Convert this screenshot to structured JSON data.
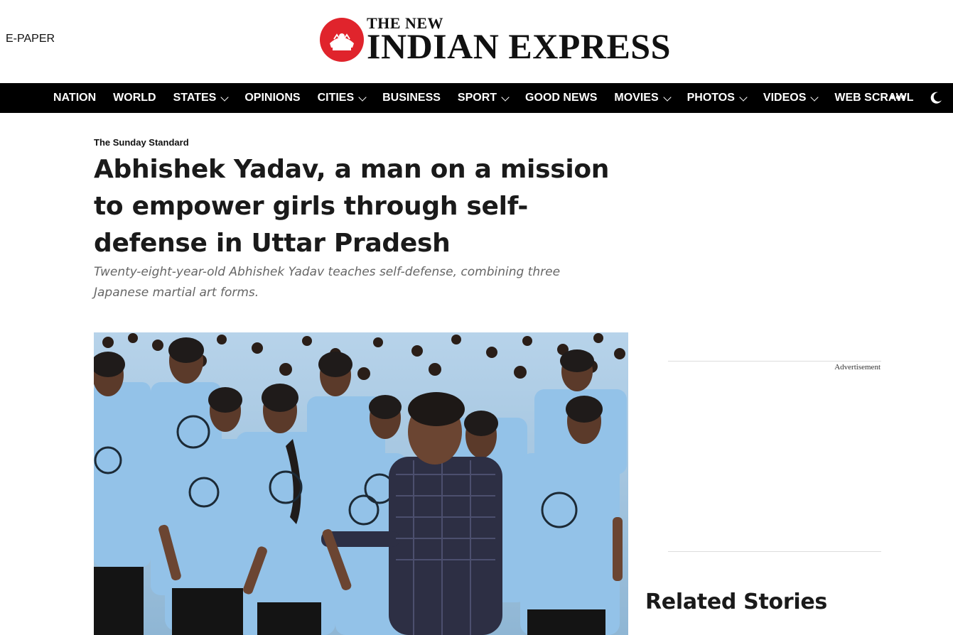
{
  "header": {
    "epaper_label": "E-PAPER",
    "logo_line1": "THE NEW",
    "logo_line2": "INDIAN EXPRESS"
  },
  "nav": {
    "items": [
      {
        "label": "NATION",
        "dropdown": false
      },
      {
        "label": "WORLD",
        "dropdown": false
      },
      {
        "label": "STATES",
        "dropdown": true
      },
      {
        "label": "OPINIONS",
        "dropdown": false
      },
      {
        "label": "CITIES",
        "dropdown": true
      },
      {
        "label": "BUSINESS",
        "dropdown": false
      },
      {
        "label": "SPORT",
        "dropdown": true
      },
      {
        "label": "GOOD NEWS",
        "dropdown": false
      },
      {
        "label": "MOVIES",
        "dropdown": true
      },
      {
        "label": "PHOTOS",
        "dropdown": true
      },
      {
        "label": "VIDEOS",
        "dropdown": true
      },
      {
        "label": "WEB SCRAWL",
        "dropdown": false
      }
    ],
    "more_label": "•••",
    "theme_icon": "moon-icon"
  },
  "article": {
    "section": "The Sunday Standard",
    "title": "Abhishek Yadav, a man on a mission to empower girls through self-defense in Uttar Pradesh",
    "subtitle": "Twenty-eight-year-old Abhishek Yadav teaches self-defense, combining three Japanese martial art forms."
  },
  "sidebar": {
    "advertisement_label": "Advertisement",
    "related_title": "Related Stories"
  },
  "colors": {
    "brand_red": "#e0242c",
    "nav_bg": "#000000",
    "tshirt_blue": "#8fc0e6"
  }
}
